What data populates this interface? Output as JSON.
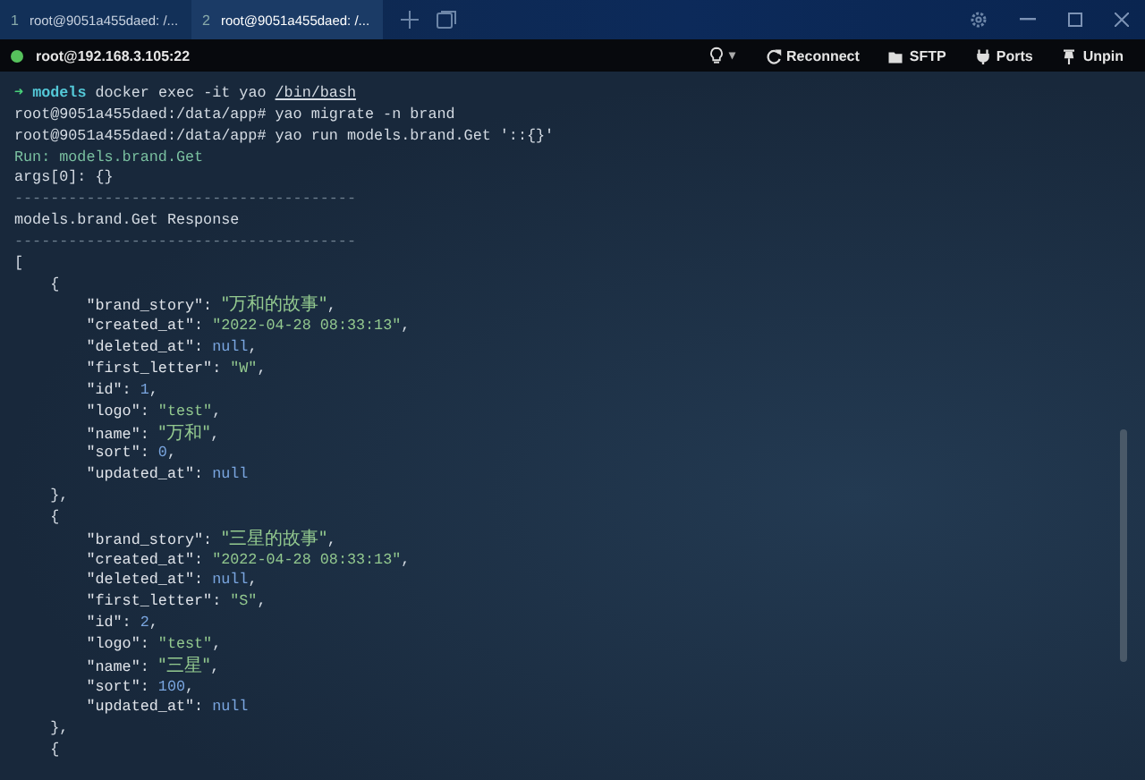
{
  "tabs": [
    {
      "number": "1",
      "title": "root@9051a455daed: /...",
      "selected": false
    },
    {
      "number": "2",
      "title": "root@9051a455daed: /...",
      "selected": true
    }
  ],
  "toolbar": {
    "host": "root@192.168.3.105:22",
    "connected": true,
    "buttons": [
      {
        "kind": "bulb",
        "caret": "▾"
      },
      {
        "kind": "reconnect",
        "label": "Reconnect"
      },
      {
        "kind": "sftp",
        "label": "SFTP"
      },
      {
        "kind": "ports",
        "label": "Ports"
      },
      {
        "kind": "unpin",
        "label": "Unpin"
      }
    ]
  },
  "terminal": {
    "lines": [
      [
        {
          "kind": "arrow",
          "text": "➜ "
        },
        {
          "kind": "dir",
          "text": "models"
        },
        {
          "kind": "plain",
          "text": " docker exec -it yao "
        },
        {
          "kind": "link",
          "text": "/bin/bash"
        }
      ],
      [
        {
          "kind": "plain",
          "text": "root@9051a455daed:/data/app# yao migrate -n brand"
        }
      ],
      [
        {
          "kind": "plain",
          "text": "root@9051a455daed:/data/app# yao run models.brand.Get '::{}'"
        }
      ],
      [
        {
          "kind": "info",
          "text": "Run: models.brand.Get"
        }
      ],
      [
        {
          "kind": "plain",
          "text": "args[0]: {}"
        }
      ],
      [
        {
          "kind": "rule",
          "text": "--------------------------------------"
        }
      ],
      [
        {
          "kind": "plain",
          "text": "models.brand.Get Response"
        }
      ],
      [
        {
          "kind": "rule",
          "text": "--------------------------------------"
        }
      ],
      [
        {
          "kind": "plain",
          "text": "["
        }
      ],
      [
        {
          "kind": "plain",
          "text": "    {"
        }
      ],
      [
        {
          "kind": "key",
          "text": "        \"brand_story\": "
        },
        {
          "kind": "string",
          "text": "\"万和的故事\""
        },
        {
          "kind": "plain",
          "text": ","
        }
      ],
      [
        {
          "kind": "key",
          "text": "        \"created_at\": "
        },
        {
          "kind": "string",
          "text": "\"2022-04-28 08:33:13\""
        },
        {
          "kind": "plain",
          "text": ","
        }
      ],
      [
        {
          "kind": "key",
          "text": "        \"deleted_at\": "
        },
        {
          "kind": "null",
          "text": "null"
        },
        {
          "kind": "plain",
          "text": ","
        }
      ],
      [
        {
          "kind": "key",
          "text": "        \"first_letter\": "
        },
        {
          "kind": "string",
          "text": "\"W\""
        },
        {
          "kind": "plain",
          "text": ","
        }
      ],
      [
        {
          "kind": "key",
          "text": "        \"id\": "
        },
        {
          "kind": "number",
          "text": "1"
        },
        {
          "kind": "plain",
          "text": ","
        }
      ],
      [
        {
          "kind": "key",
          "text": "        \"logo\": "
        },
        {
          "kind": "string",
          "text": "\"test\""
        },
        {
          "kind": "plain",
          "text": ","
        }
      ],
      [
        {
          "kind": "key",
          "text": "        \"name\": "
        },
        {
          "kind": "string",
          "text": "\"万和\""
        },
        {
          "kind": "plain",
          "text": ","
        }
      ],
      [
        {
          "kind": "key",
          "text": "        \"sort\": "
        },
        {
          "kind": "number",
          "text": "0"
        },
        {
          "kind": "plain",
          "text": ","
        }
      ],
      [
        {
          "kind": "key",
          "text": "        \"updated_at\": "
        },
        {
          "kind": "null",
          "text": "null"
        }
      ],
      [
        {
          "kind": "plain",
          "text": "    },"
        }
      ],
      [
        {
          "kind": "plain",
          "text": "    {"
        }
      ],
      [
        {
          "kind": "key",
          "text": "        \"brand_story\": "
        },
        {
          "kind": "string",
          "text": "\"三星的故事\""
        },
        {
          "kind": "plain",
          "text": ","
        }
      ],
      [
        {
          "kind": "key",
          "text": "        \"created_at\": "
        },
        {
          "kind": "string",
          "text": "\"2022-04-28 08:33:13\""
        },
        {
          "kind": "plain",
          "text": ","
        }
      ],
      [
        {
          "kind": "key",
          "text": "        \"deleted_at\": "
        },
        {
          "kind": "null",
          "text": "null"
        },
        {
          "kind": "plain",
          "text": ","
        }
      ],
      [
        {
          "kind": "key",
          "text": "        \"first_letter\": "
        },
        {
          "kind": "string",
          "text": "\"S\""
        },
        {
          "kind": "plain",
          "text": ","
        }
      ],
      [
        {
          "kind": "key",
          "text": "        \"id\": "
        },
        {
          "kind": "number",
          "text": "2"
        },
        {
          "kind": "plain",
          "text": ","
        }
      ],
      [
        {
          "kind": "key",
          "text": "        \"logo\": "
        },
        {
          "kind": "string",
          "text": "\"test\""
        },
        {
          "kind": "plain",
          "text": ","
        }
      ],
      [
        {
          "kind": "key",
          "text": "        \"name\": "
        },
        {
          "kind": "string",
          "text": "\"三星\""
        },
        {
          "kind": "plain",
          "text": ","
        }
      ],
      [
        {
          "kind": "key",
          "text": "        \"sort\": "
        },
        {
          "kind": "number",
          "text": "100"
        },
        {
          "kind": "plain",
          "text": ","
        }
      ],
      [
        {
          "kind": "key",
          "text": "        \"updated_at\": "
        },
        {
          "kind": "null",
          "text": "null"
        }
      ],
      [
        {
          "kind": "plain",
          "text": "    },"
        }
      ],
      [
        {
          "kind": "plain",
          "text": "    {"
        }
      ]
    ]
  }
}
